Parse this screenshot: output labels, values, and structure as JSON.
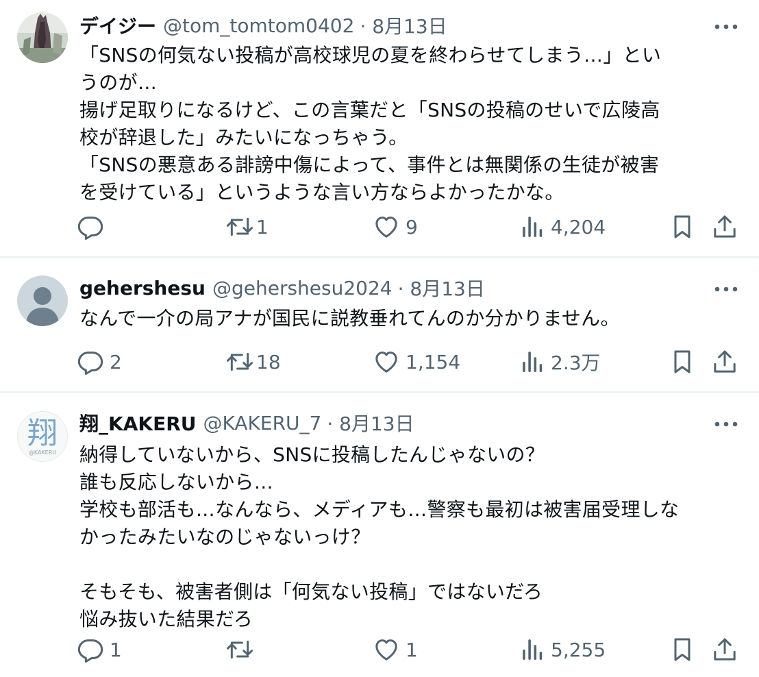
{
  "tweets": [
    {
      "name": "デイジー",
      "handle": "@tom_tomtom0402",
      "date": "· 8月13日",
      "text": "「SNSの何気ない投稿が高校球児の夏を終わらせてしまう…」とい\nうのが…\n揚げ足取りになるけど、この言葉だと「SNSの投稿のせいで広陵高\n校が辞退した」みたいになっちゃう。\n「SNSの悪意ある誹謗中傷によって、事件とは無関係の生徒が被害\nを受けている」というような言い方ならよかったかな。",
      "replies": "",
      "retweets": "1",
      "likes": "9",
      "views": "4,204",
      "avatar_icon": "photo-avatar"
    },
    {
      "name": "gehershesu",
      "handle": "@gehershesu2024",
      "date": "· 8月13日",
      "text": "なんで一介の局アナが国民に説教垂れてんのか分かりません。",
      "replies": "2",
      "retweets": "18",
      "likes": "1,154",
      "views": "2.3万",
      "avatar_icon": "default-person-avatar"
    },
    {
      "name": "翔_KAKERU",
      "handle": "@KAKERU_7",
      "date": "· 8月13日",
      "text": "納得していないから、SNSに投稿したんじゃないの？\n誰も反応しないから…\n学校も部活も…なんなら、メディアも…警察も最初は被害届受理しな\nかったみたいなのじゃないっけ？\n\nそもそも、被害者側は「何気ない投稿」ではないだろ\n悩み抜いた結果だろ",
      "replies": "1",
      "retweets": "",
      "likes": "1",
      "views": "5,255",
      "avatar_text": "翔",
      "avatar_sub": "@KAKERU"
    }
  ],
  "colors": {
    "text": "#0f1419",
    "muted": "#536471",
    "divider": "#eff3f4"
  },
  "icons": [
    "more-icon",
    "reply-icon",
    "retweet-icon",
    "like-icon",
    "views-icon",
    "bookmark-icon",
    "share-icon"
  ]
}
